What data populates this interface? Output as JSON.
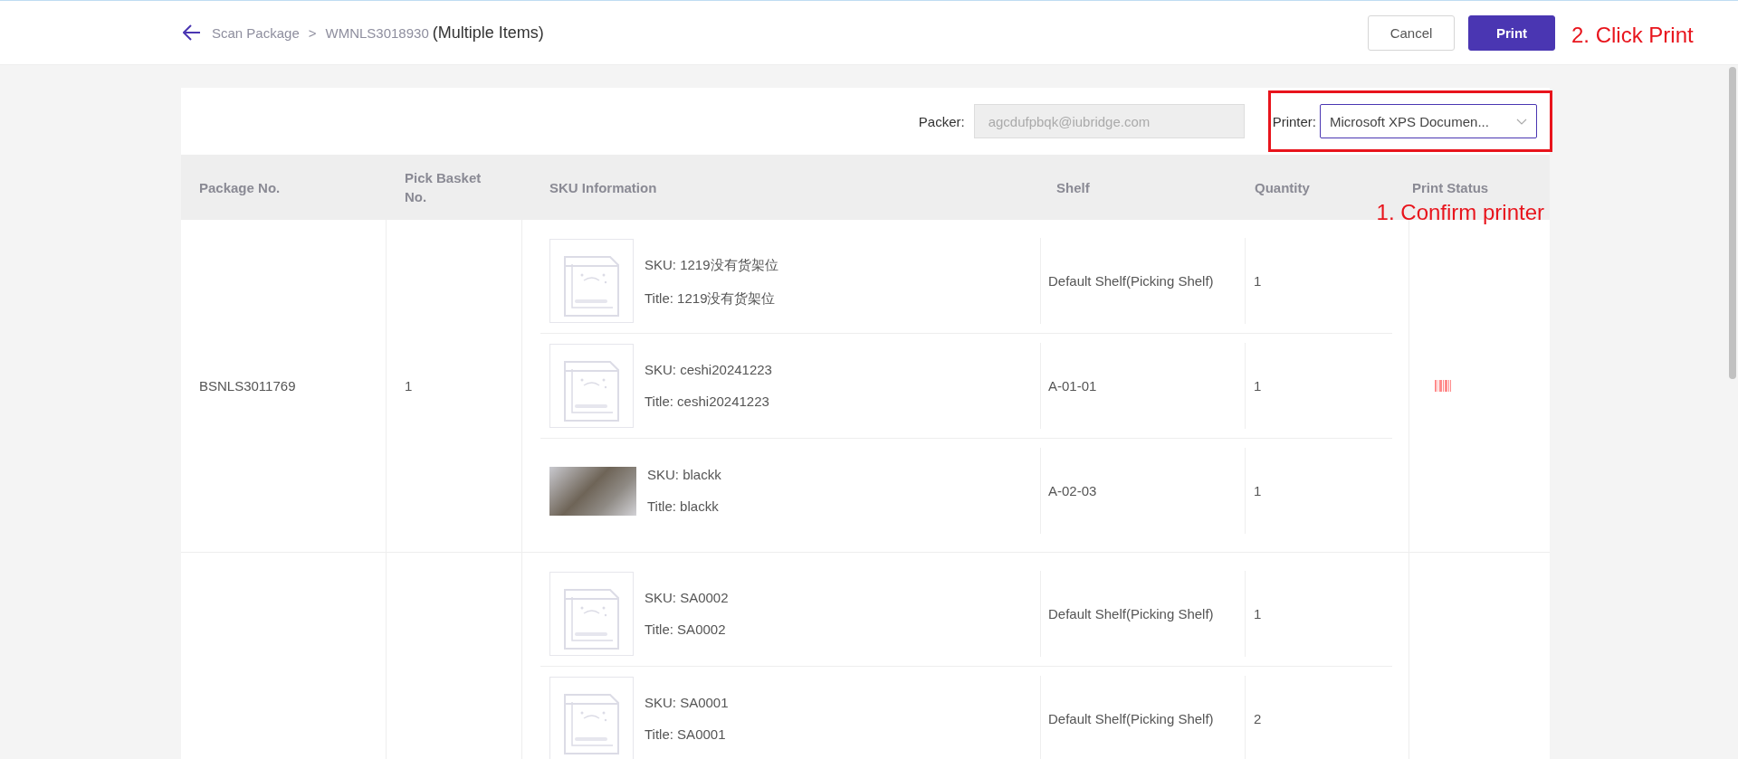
{
  "header": {
    "back_label": "Scan Package",
    "separator": ">",
    "order_no": "WMNLS3018930",
    "suffix": "(Multiple Items)",
    "buttons": [
      {
        "label": "Cancel",
        "kind": "secondary"
      },
      {
        "label": "Print",
        "kind": "primary"
      }
    ],
    "note": "2. Click Print"
  },
  "toolbar": {
    "packer": {
      "label": "Packer:",
      "value": "agcdufpbqk@iubridge.com",
      "disabled": true
    },
    "printer": {
      "label": "Printer:",
      "value": "Microsoft XPS Documen...",
      "highlighted": true,
      "note": "1. Confirm printer"
    }
  },
  "table": {
    "columns": [
      "Package No.",
      "Pick Basket No.",
      "SKU Information",
      "Shelf",
      "Quantity",
      "Print Status"
    ],
    "packages": [
      {
        "package_no": "BSNLS3011769",
        "pick_basket_no": "1",
        "print_status": {
          "kind": "barcode"
        },
        "items": [
          {
            "kind": "no-image",
            "sku": "SKU: 1219没有货架位",
            "title": "Title: 1219没有货架位",
            "shelf": "Default Shelf(Picking Shelf)",
            "quantity": "1"
          },
          {
            "kind": "no-image",
            "sku": "SKU: ceshi20241223",
            "title": "Title: ceshi20241223",
            "shelf": "A-01-01",
            "quantity": "1"
          },
          {
            "kind": "photo",
            "sku": "SKU: blackk",
            "title": "Title: blackk",
            "shelf": "A-02-03",
            "quantity": "1"
          }
        ]
      },
      {
        "items": [
          {
            "kind": "no-image",
            "sku": "SKU: SA0002",
            "title": "Title: SA0002",
            "shelf": "Default Shelf(Picking Shelf)",
            "quantity": "1"
          },
          {
            "kind": "no-image",
            "sku": "SKU: SA0001",
            "title": "Title: SA0001",
            "shelf": "Default Shelf(Picking Shelf)",
            "quantity": "2"
          }
        ]
      }
    ]
  }
}
